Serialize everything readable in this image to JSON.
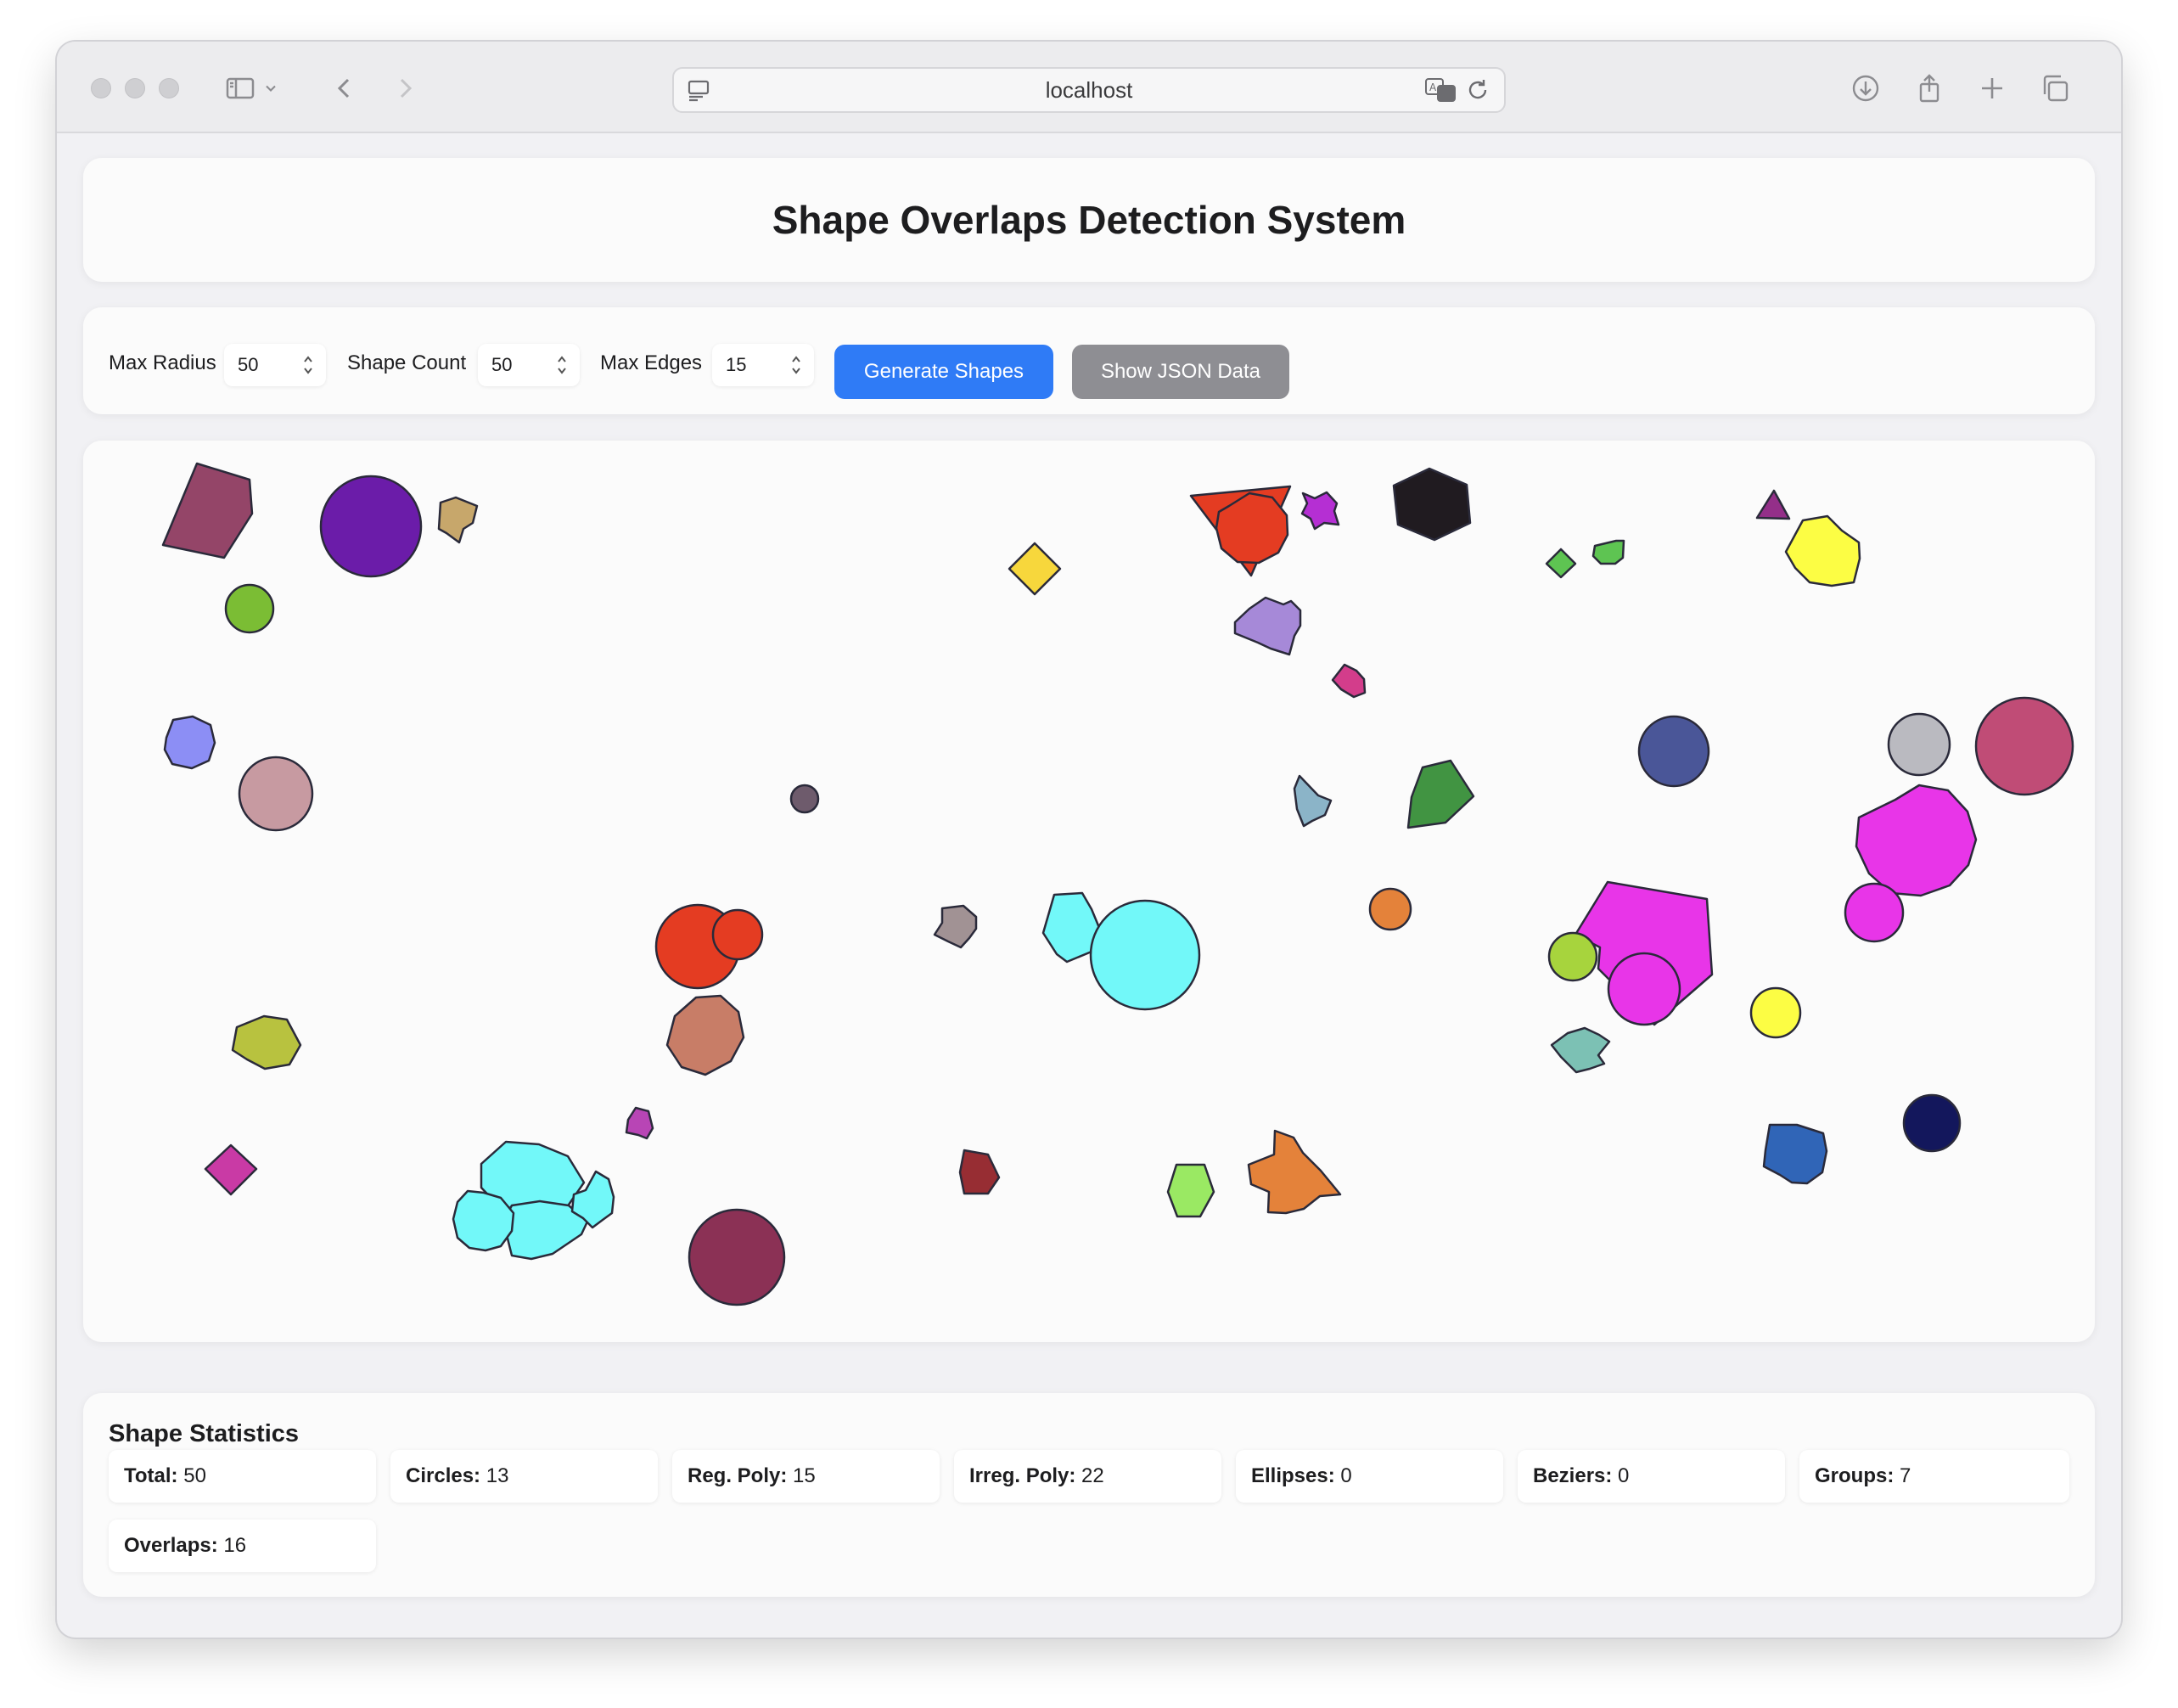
{
  "browser": {
    "url": "localhost"
  },
  "header": {
    "title": "Shape Overlaps Detection System"
  },
  "controls": {
    "max_radius": {
      "label": "Max Radius",
      "value": "50"
    },
    "shape_count": {
      "label": "Shape Count",
      "value": "50"
    },
    "max_edges": {
      "label": "Max Edges",
      "value": "15"
    },
    "generate_label": "Generate Shapes",
    "json_label": "Show JSON Data"
  },
  "colors": {
    "primary_button": "#2f7bf6",
    "secondary_button": "#8e8e93",
    "shape_stroke": "#2a2a3a"
  },
  "stats": {
    "title": "Shape Statistics",
    "items": [
      {
        "label": "Total:",
        "value": "50"
      },
      {
        "label": "Circles:",
        "value": "13"
      },
      {
        "label": "Reg. Poly:",
        "value": "15"
      },
      {
        "label": "Irreg. Poly:",
        "value": "22"
      },
      {
        "label": "Ellipses:",
        "value": "0"
      },
      {
        "label": "Beziers:",
        "value": "0"
      },
      {
        "label": "Groups:",
        "value": "7"
      },
      {
        "label": "Overlaps:",
        "value": "16"
      }
    ]
  }
}
